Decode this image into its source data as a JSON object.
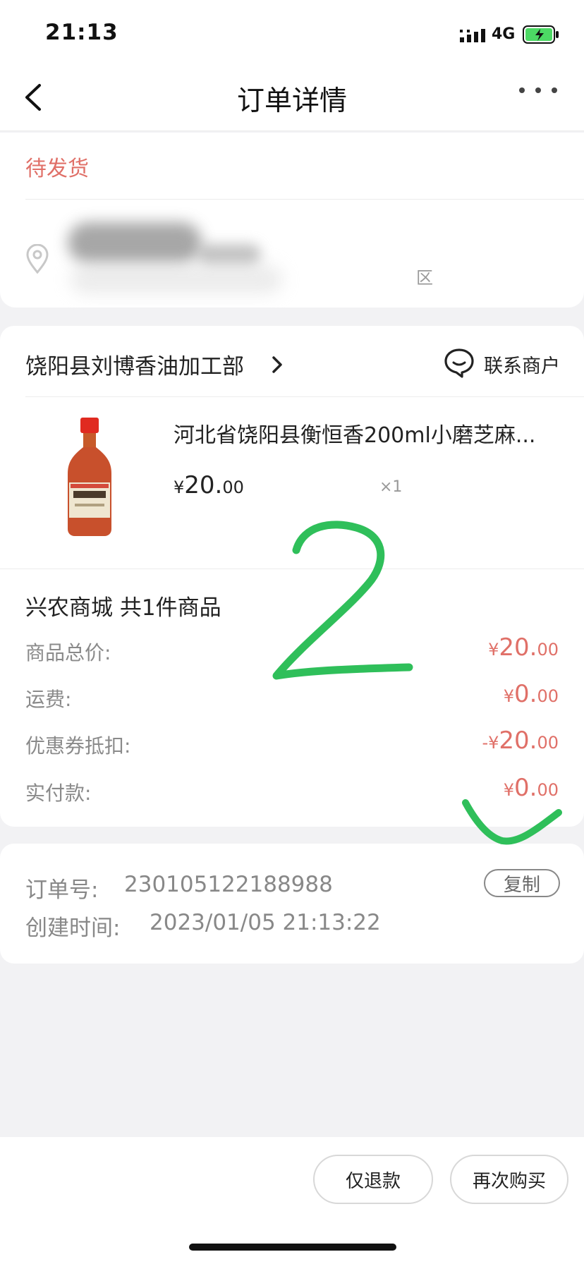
{
  "status_bar": {
    "time": "21:13",
    "network": "4G",
    "signal_icon": "signal-bars-icon",
    "battery_icon": "battery-charging-icon"
  },
  "nav": {
    "title": "订单详情",
    "back_icon": "chevron-left-icon",
    "more_icon": "more-dots-icon"
  },
  "order_status": "待发货",
  "address": {
    "visible_fragment": "区",
    "location_icon": "location-pin-icon"
  },
  "shop": {
    "name": "饶阳县刘博香油加工部",
    "contact_label": "联系商户",
    "contact_icon": "chat-bubble-icon"
  },
  "product": {
    "name": "河北省饶阳县衡恒香200ml小磨芝麻...",
    "price_symbol": "¥",
    "price_int": "20.",
    "price_dec": "00",
    "quantity": "×1"
  },
  "summary": {
    "title": "兴农商城 共1件商品",
    "rows": [
      {
        "label": "商品总价:",
        "symbol": "¥",
        "int": "20.",
        "dec": "00"
      },
      {
        "label": "运费:",
        "symbol": "¥",
        "int": "0.",
        "dec": "00"
      },
      {
        "label": "优惠券抵扣:",
        "symbol": "-¥",
        "int": "20.",
        "dec": "00"
      },
      {
        "label": "实付款:",
        "symbol": "¥",
        "int": "0.",
        "dec": "00"
      }
    ]
  },
  "order_info": {
    "order_no_label": "订单号:",
    "order_no": "230105122188988",
    "copy_label": "复制",
    "created_label": "创建时间:",
    "created_time": "2023/01/05 21:13:22"
  },
  "actions": {
    "refund_label": "仅退款",
    "rebuy_label": "再次购买"
  },
  "colors": {
    "accent_red": "#e07068",
    "annotation_green": "#2fbf5a"
  }
}
